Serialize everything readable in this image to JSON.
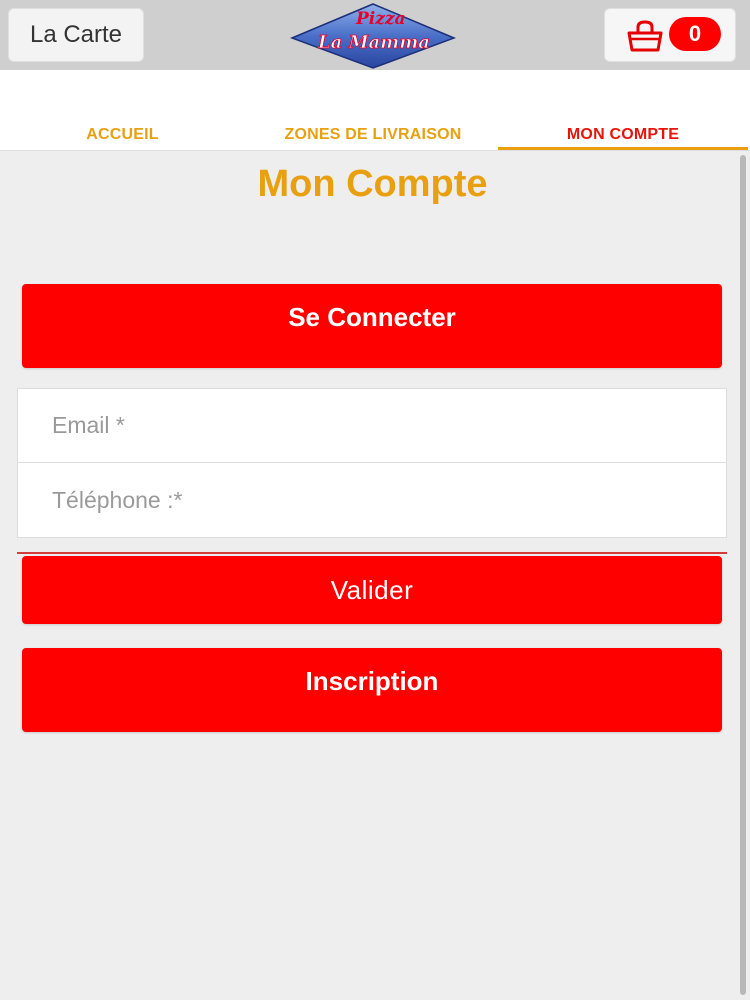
{
  "header": {
    "menu_label": "La Carte",
    "logo_line1": "Pizza",
    "logo_line2": "La Mamma",
    "cart_count": "0"
  },
  "tabs": [
    {
      "label": "ACCUEIL",
      "active": false
    },
    {
      "label": "ZONES DE LIVRAISON",
      "active": false
    },
    {
      "label": "MON COMPTE",
      "active": true
    }
  ],
  "main": {
    "title": "Mon Compte",
    "login_button": "Se Connecter",
    "email_placeholder": "Email *",
    "phone_placeholder": "Téléphone :*",
    "submit_button": "Valider",
    "signup_button": "Inscription"
  },
  "colors": {
    "accent_orange": "#e8a010",
    "button_red": "#ff0000",
    "active_tab_red": "#e8140a",
    "background_gray": "#eeeeee"
  },
  "icons": {
    "cart": "shopping-bag-icon"
  }
}
